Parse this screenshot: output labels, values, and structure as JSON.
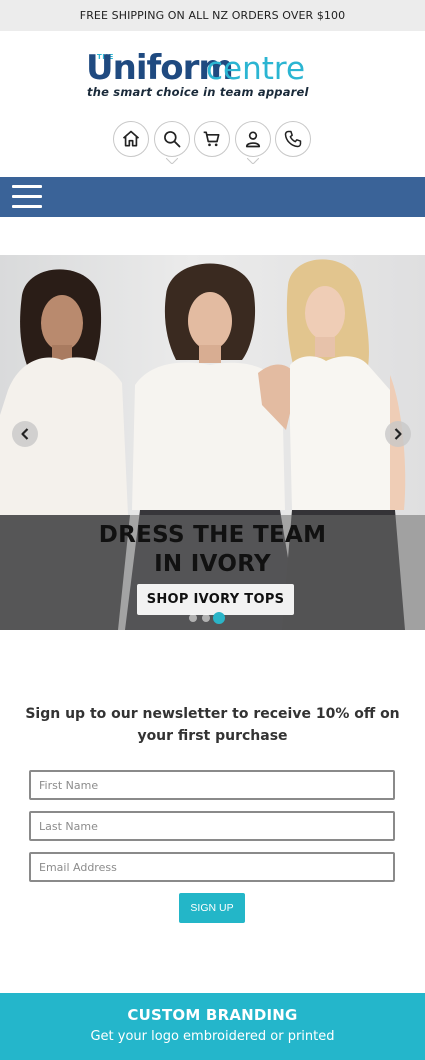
{
  "topbar": {
    "text": "FREE SHIPPING ON ALL NZ ORDERS OVER $100"
  },
  "logo": {
    "the": "THE",
    "uniform": "Uniform",
    "centre": "centre",
    "tagline": "the smart choice in team apparel"
  },
  "icons": [
    "home-icon",
    "search-icon",
    "cart-icon",
    "account-icon",
    "phone-icon"
  ],
  "colors": {
    "nav": "#3a6398",
    "accent": "#24b6cb",
    "brand_dark": "#1f4a80"
  },
  "hero": {
    "title_line1": "DRESS THE TEAM",
    "title_line2": "IN IVORY",
    "button": "SHOP IVORY TOPS",
    "slides": 3,
    "active_slide": 3
  },
  "newsletter": {
    "heading": "Sign up to our newsletter to receive 10% off on your first purchase",
    "first_name_placeholder": "First Name",
    "last_name_placeholder": "Last Name",
    "email_placeholder": "Email Address",
    "button": "SIGN UP"
  },
  "branding": {
    "title": "CUSTOM BRANDING",
    "subtitle": "Get your logo embroidered or printed"
  }
}
